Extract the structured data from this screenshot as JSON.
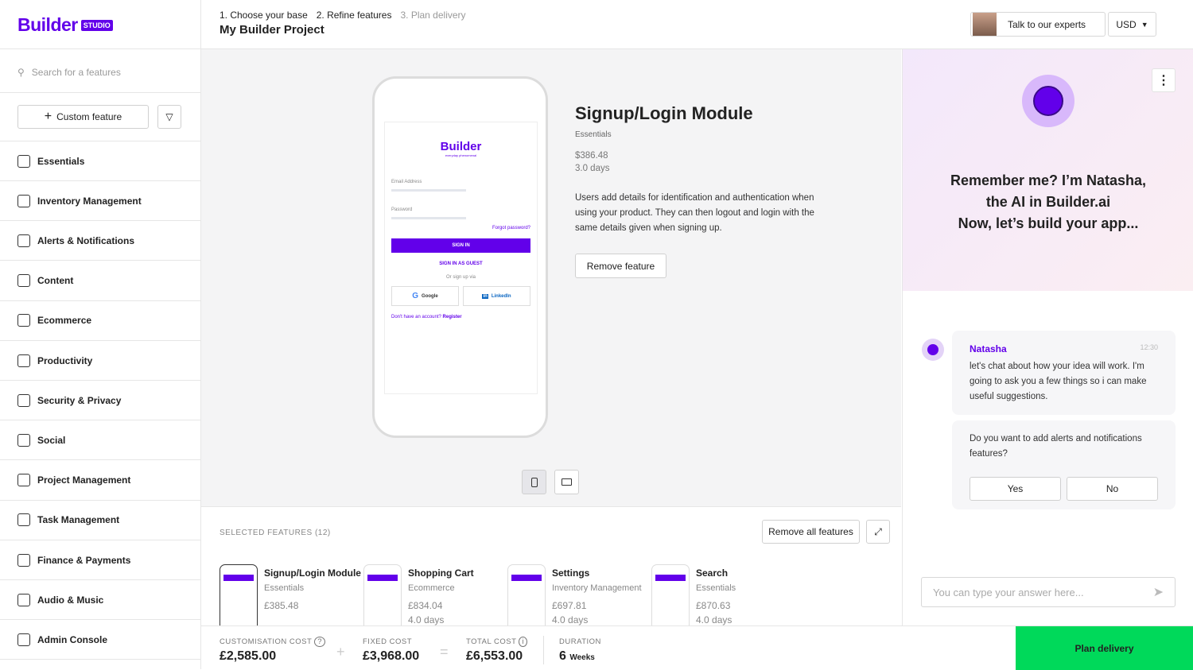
{
  "brand": {
    "name": "Builder",
    "badge": "STUDIO",
    "accent": "#6200ea"
  },
  "sidebar": {
    "search_placeholder": "Search for a features",
    "custom_feature": "Custom feature",
    "items": [
      {
        "label": "Essentials"
      },
      {
        "label": "Inventory Management"
      },
      {
        "label": "Alerts & Notifications"
      },
      {
        "label": "Content"
      },
      {
        "label": "Ecommerce"
      },
      {
        "label": "Productivity"
      },
      {
        "label": "Security & Privacy"
      },
      {
        "label": "Social"
      },
      {
        "label": "Project Management"
      },
      {
        "label": "Task Management"
      },
      {
        "label": "Finance & Payments"
      },
      {
        "label": "Audio & Music"
      },
      {
        "label": "Admin Console"
      }
    ]
  },
  "header": {
    "steps": [
      "1. Choose your base",
      "2. Refine features",
      "3. Plan delivery"
    ],
    "title": "My Builder Project",
    "experts": "Talk to our experts",
    "currency": "USD"
  },
  "feature": {
    "title": "Signup/Login Module",
    "category": "Essentials",
    "price": "$386.48",
    "duration": "3.0 days",
    "description": "Users add details for identification and authentication when using your product. They can then logout and login with the same details given when signing up.",
    "remove": "Remove feature"
  },
  "preview": {
    "logo": "Builder",
    "tagline": "everyday phenomenal",
    "email": "Email Address",
    "password": "Password",
    "forgot": "Forgot password?",
    "signin": "SIGN IN",
    "guest": "SIGN IN AS GUEST",
    "or": "Or sign up via",
    "google": "Google",
    "linkedin": "LinkedIn",
    "no_account": "Don't have an account?",
    "register": "Register"
  },
  "selected": {
    "label": "SELECTED FEATURES (12)",
    "remove_all": "Remove all features",
    "items": [
      {
        "name": "Signup/Login Module",
        "category": "Essentials",
        "price": "£385.48",
        "duration": ""
      },
      {
        "name": "Shopping Cart",
        "category": "Ecommerce",
        "price": "£834.04",
        "duration": "4.0 days"
      },
      {
        "name": "Settings",
        "category": "Inventory Management",
        "price": "£697.81",
        "duration": "4.0 days"
      },
      {
        "name": "Search",
        "category": "Essentials",
        "price": "£870.63",
        "duration": "4.0 days"
      }
    ]
  },
  "footer": {
    "custom_label": "CUSTOMISATION COST",
    "custom_value": "£2,585.00",
    "fixed_label": "FIXED COST",
    "fixed_value": "£3,968.00",
    "total_label": "TOTAL COST",
    "total_value": "£6,553.00",
    "duration_label": "DURATION",
    "duration_value": "6",
    "duration_unit": "Weeks",
    "plan": "Plan delivery",
    "plan_color": "#00d95a"
  },
  "chat": {
    "greeting": [
      "Remember me? I’m Natasha,",
      "the AI in Builder.ai",
      "Now, let’s build your app..."
    ],
    "sender": "Natasha",
    "time": "12:30",
    "message": "let's chat about how your idea will work. I'm going to ask you a few things so i can make useful suggestions.",
    "question": "Do you want to add alerts and notifications features?",
    "yes": "Yes",
    "no": "No",
    "input_placeholder": "You can type your answer here..."
  }
}
